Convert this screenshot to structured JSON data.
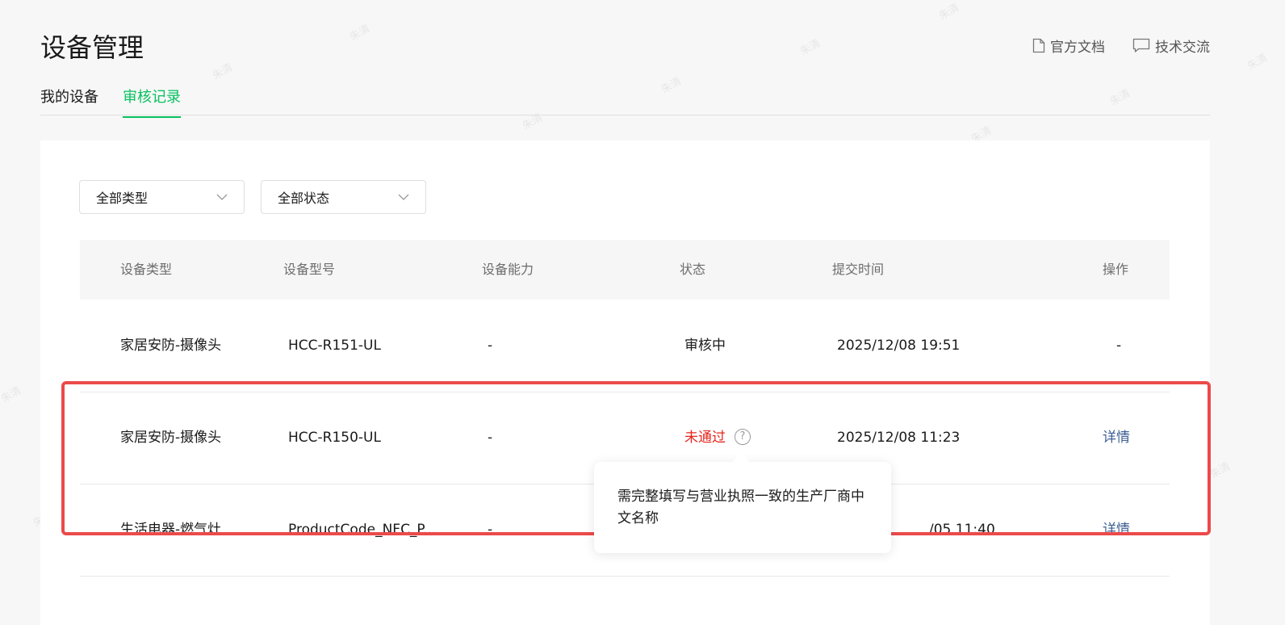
{
  "page": {
    "title": "设备管理"
  },
  "header": {
    "links": [
      {
        "label": "官方文档",
        "icon": "document-icon"
      },
      {
        "label": "技术交流",
        "icon": "chat-icon"
      }
    ]
  },
  "tabs": [
    {
      "label": "我的设备",
      "active": false
    },
    {
      "label": "审核记录",
      "active": true
    }
  ],
  "filters": {
    "type": {
      "value": "全部类型"
    },
    "status": {
      "value": "全部状态"
    }
  },
  "table": {
    "columns": [
      "设备类型",
      "设备型号",
      "设备能力",
      "状态",
      "提交时间",
      "操作"
    ],
    "rows": [
      {
        "type": "家居安防-摄像头",
        "model": "HCC-R151-UL",
        "capability": "-",
        "status": "审核中",
        "time": "2025/12/08 19:51",
        "action": "-"
      },
      {
        "type": "家居安防-摄像头",
        "model": "HCC-R150-UL",
        "capability": "-",
        "status": "未通过",
        "time": "2025/12/08 11:23",
        "action": "详情"
      },
      {
        "type": "生活电器-燃气灶",
        "model": "ProductCode_NFC_P...",
        "capability": "-",
        "status": "",
        "time": "/05 11:40",
        "action": "详情"
      }
    ]
  },
  "help_glyph": "?",
  "tooltip": {
    "text": "需完整填写与营业执照一致的生产厂商中文名称"
  },
  "colors": {
    "accent": "#07c160",
    "error": "#e5261e",
    "link": "#3e5f94",
    "highlight": "#ec4a4a"
  },
  "watermark": {
    "text": "朱清"
  }
}
